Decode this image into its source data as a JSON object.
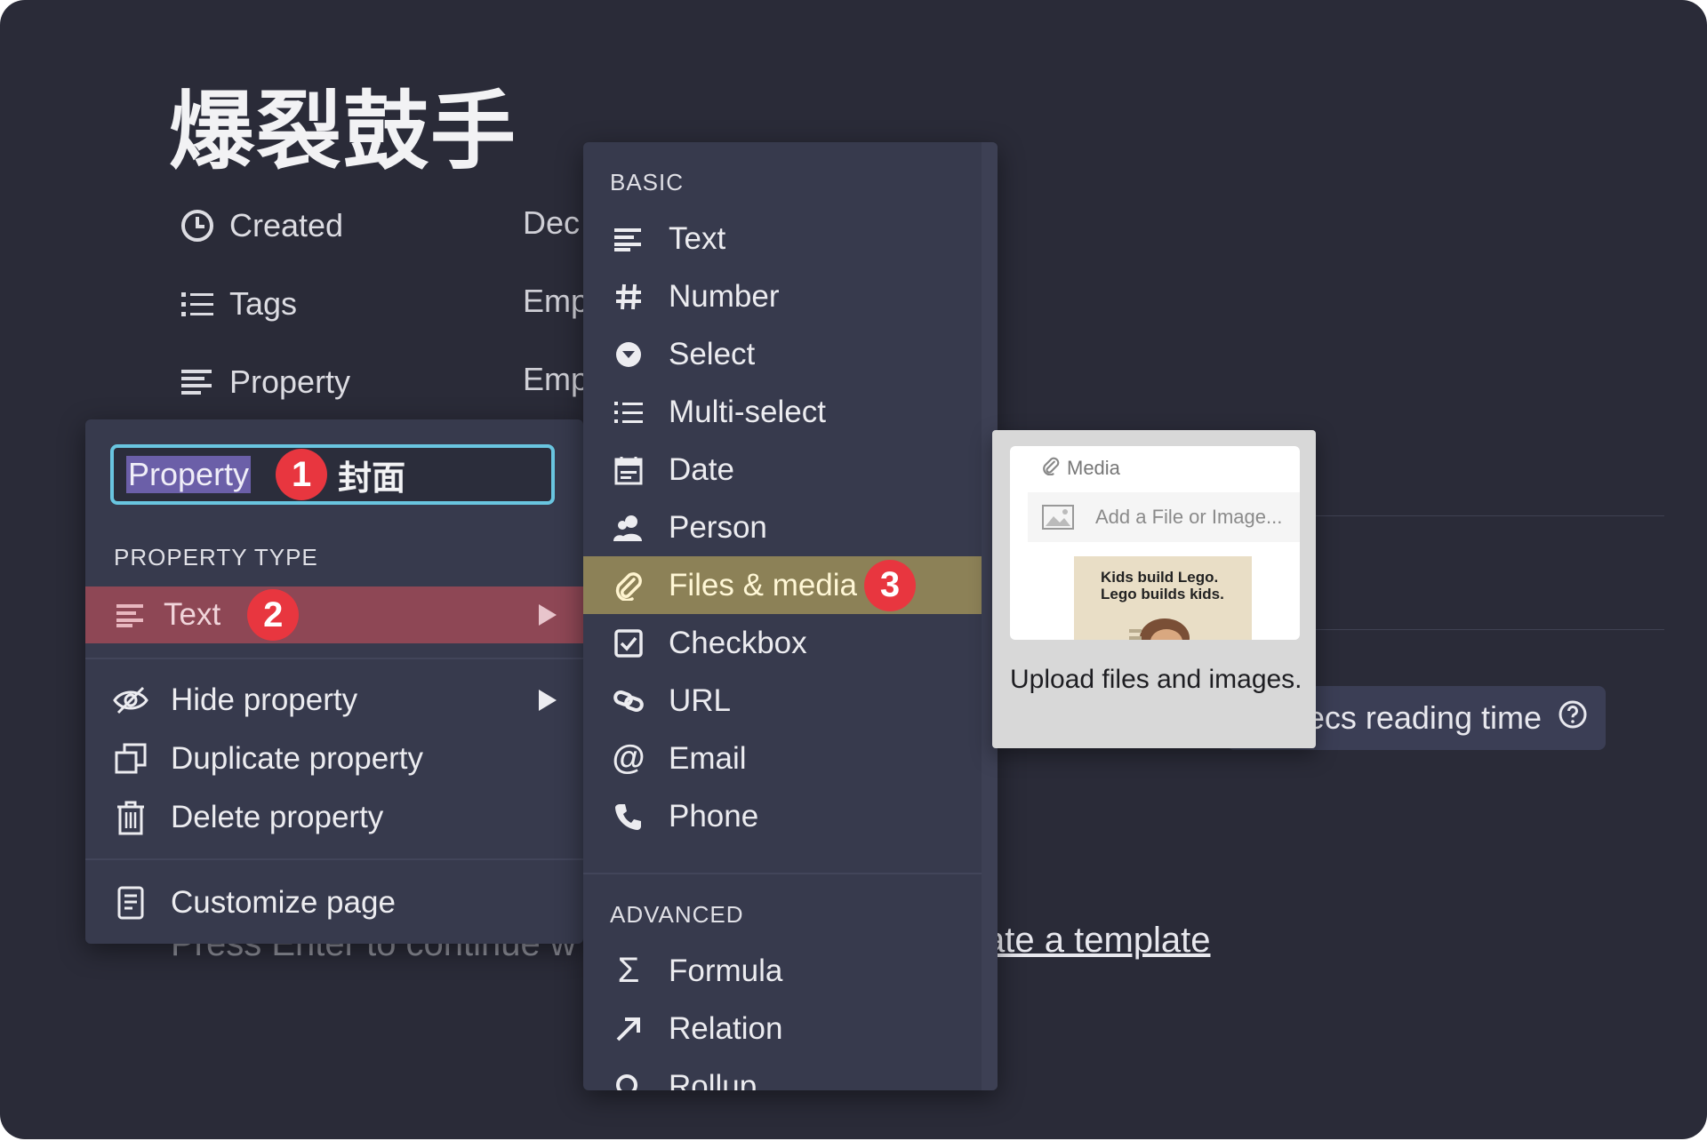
{
  "page": {
    "title": "爆裂鼓手",
    "properties": [
      {
        "label": "Created",
        "value": "Dec",
        "icon": "clock-icon"
      },
      {
        "label": "Tags",
        "value": "Emp",
        "icon": "list-icon"
      },
      {
        "label": "Property",
        "value": "Emp",
        "icon": "text-lines-icon"
      }
    ],
    "reading_time": "ecs reading time",
    "footer_hint": "Press Enter to continue w",
    "template_link": "ate a template"
  },
  "property_menu": {
    "name_value": "Property",
    "name_suffix": "封面",
    "section_label": "PROPERTY TYPE",
    "current_type": "Text",
    "actions": [
      {
        "label": "Hide property",
        "icon": "eye-off-icon"
      },
      {
        "label": "Duplicate property",
        "icon": "duplicate-icon"
      },
      {
        "label": "Delete property",
        "icon": "trash-icon"
      }
    ],
    "customize": {
      "label": "Customize page",
      "icon": "document-icon"
    }
  },
  "annotations": {
    "step1": "1",
    "step2": "2",
    "step3": "3",
    "color": "#e8363f"
  },
  "type_menu": {
    "basic_label": "BASIC",
    "basic": [
      {
        "label": "Text",
        "icon": "text-lines-icon"
      },
      {
        "label": "Number",
        "icon": "hash-icon"
      },
      {
        "label": "Select",
        "icon": "select-icon"
      },
      {
        "label": "Multi-select",
        "icon": "list-icon"
      },
      {
        "label": "Date",
        "icon": "calendar-icon"
      },
      {
        "label": "Person",
        "icon": "person-icon"
      },
      {
        "label": "Files & media",
        "icon": "paperclip-icon",
        "highlighted": true
      },
      {
        "label": "Checkbox",
        "icon": "checkbox-icon"
      },
      {
        "label": "URL",
        "icon": "link-icon"
      },
      {
        "label": "Email",
        "icon": "at-icon"
      },
      {
        "label": "Phone",
        "icon": "phone-icon"
      }
    ],
    "advanced_label": "ADVANCED",
    "advanced": [
      {
        "label": "Formula",
        "icon": "sigma-icon"
      },
      {
        "label": "Relation",
        "icon": "arrow-up-right-icon"
      },
      {
        "label": "Rollup",
        "icon": "search-icon"
      }
    ]
  },
  "preview": {
    "header": "Media",
    "add_label": "Add a File or Image...",
    "image_caption": "Kids build Lego.\nLego builds kids.",
    "description": "Upload files and images."
  }
}
